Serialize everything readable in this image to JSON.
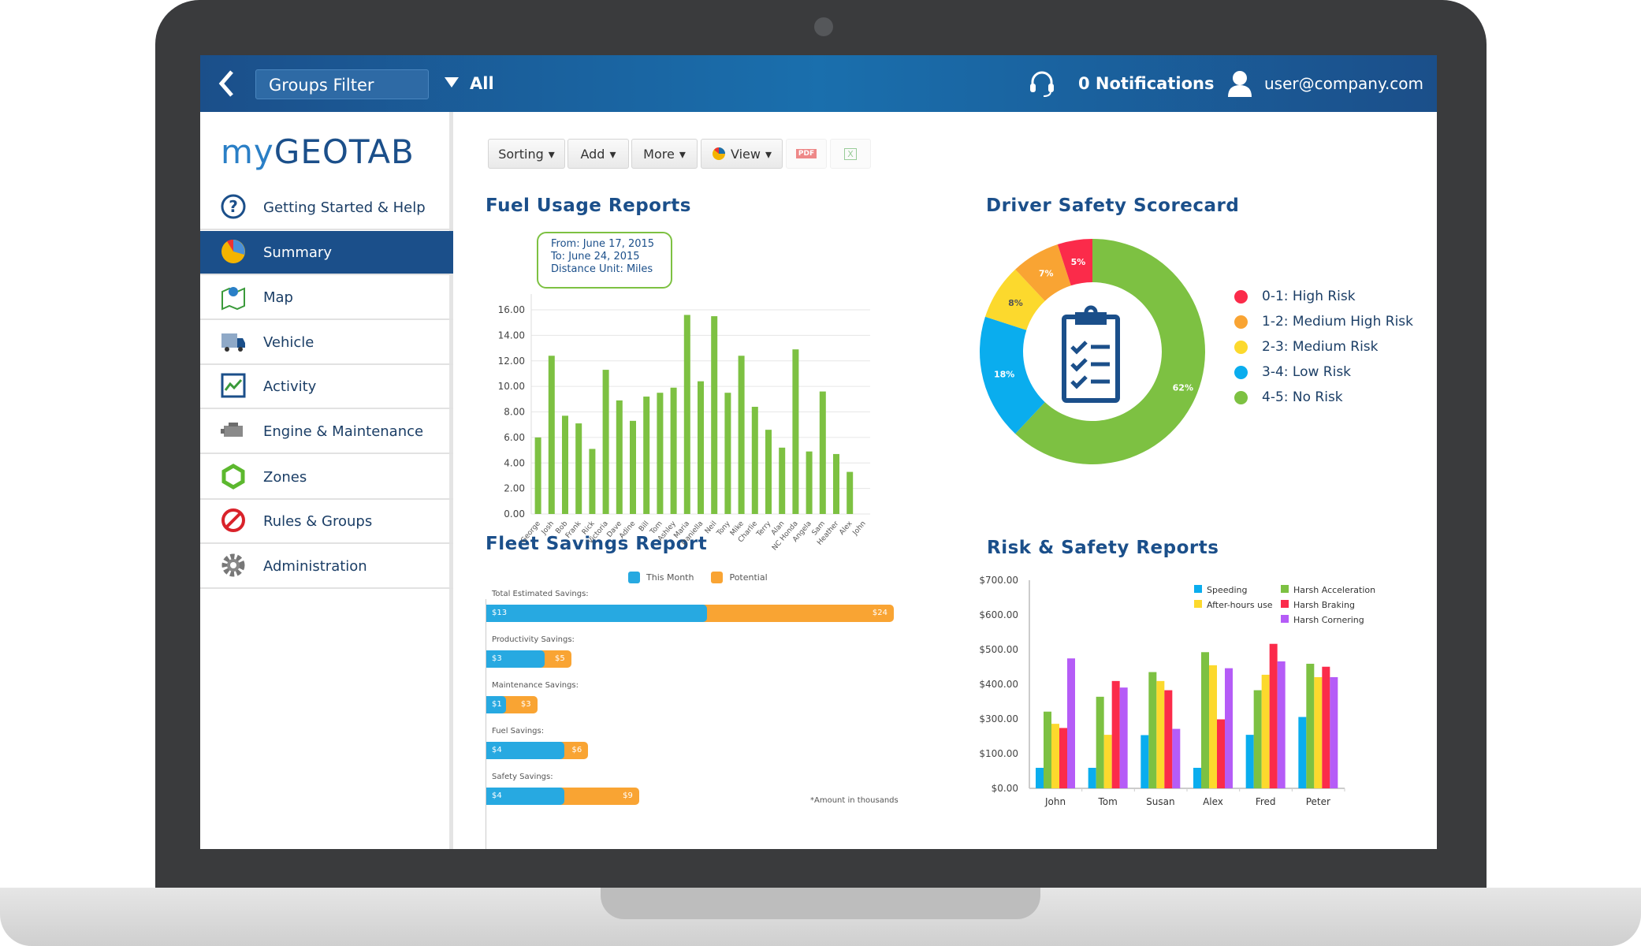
{
  "topbar": {
    "groups_filter": "Groups Filter",
    "filter_value": "All",
    "notifications": "0 Notifications",
    "user": "user@company.com"
  },
  "logo": {
    "prefix": "my",
    "name": "GEOTAB"
  },
  "sidebar": {
    "items": [
      {
        "label": "Getting Started & Help",
        "icon": "help-icon"
      },
      {
        "label": "Summary",
        "icon": "pie-chart-icon",
        "active": true
      },
      {
        "label": "Map",
        "icon": "map-icon"
      },
      {
        "label": "Vehicle",
        "icon": "truck-icon"
      },
      {
        "label": "Activity",
        "icon": "activity-icon"
      },
      {
        "label": "Engine & Maintenance",
        "icon": "engine-icon"
      },
      {
        "label": "Zones",
        "icon": "zones-icon"
      },
      {
        "label": "Rules & Groups",
        "icon": "prohibited-icon"
      },
      {
        "label": "Administration",
        "icon": "gear-icon"
      }
    ]
  },
  "toolbar": {
    "sorting": "Sorting",
    "add": "Add",
    "more": "More",
    "view": "View",
    "pdf": "PDF",
    "excel": "X"
  },
  "fuel": {
    "title": "Fuel Usage Reports",
    "tooltip": [
      "From: June 17, 2015",
      "To: June 24, 2015",
      "Distance Unit: Miles"
    ]
  },
  "safety": {
    "title": "Driver Safety Scorecard"
  },
  "savings": {
    "title": "Fleet Savings Report",
    "note": "*Amount in thousands"
  },
  "risk": {
    "title": "Risk & Safety Reports"
  },
  "chart_data": [
    {
      "type": "bar",
      "title": "Fuel Usage Reports",
      "ylim": [
        0,
        16
      ],
      "yticks": [
        "0.00",
        "2.00",
        "4.00",
        "6.00",
        "8.00",
        "10.00",
        "12.00",
        "14.00",
        "16.00"
      ],
      "grid": true,
      "color": "#7dc142",
      "categories": [
        "George",
        "Josh",
        "Bob",
        "Frank",
        "Rick",
        "Victoria",
        "Dave",
        "Adine",
        "Bill",
        "Tom",
        "Ashley",
        "Maria",
        "Daniella",
        "Neil",
        "Tony",
        "Mike",
        "Charlie",
        "Terry",
        "Alan",
        "NC Honda",
        "Angela",
        "Sam",
        "Heather",
        "Alex",
        "John"
      ],
      "values": [
        6.0,
        12.4,
        7.7,
        7.1,
        5.1,
        11.3,
        8.9,
        7.3,
        9.2,
        9.5,
        9.9,
        15.6,
        10.4,
        15.5,
        9.5,
        12.4,
        8.4,
        6.6,
        5.2,
        12.9,
        4.9,
        9.6,
        4.7,
        3.3,
        0
      ]
    },
    {
      "type": "pie",
      "title": "Driver Safety Scorecard",
      "donut": true,
      "legend": "right",
      "slices": [
        {
          "label": "4-5: No Risk",
          "value": 62,
          "color": "#7dc142"
        },
        {
          "label": "3-4: Low Risk",
          "value": 18,
          "color": "#0aadee"
        },
        {
          "label": "2-3: Medium Risk",
          "value": 8,
          "color": "#fcd92d"
        },
        {
          "label": "1-2: Medium High Risk",
          "value": 7,
          "color": "#f9a433"
        },
        {
          "label": "0-1: High Risk",
          "value": 5,
          "color": "#fb2b4a"
        }
      ],
      "legend_order": [
        "0-1: High Risk",
        "1-2: Medium High Risk",
        "2-3: Medium Risk",
        "3-4: Low Risk",
        "4-5: No Risk"
      ]
    },
    {
      "type": "bar",
      "orientation": "horizontal",
      "stacked": false,
      "title": "Fleet Savings Report",
      "legend": "top",
      "series": [
        {
          "name": "This Month",
          "color": "#27a9e1"
        },
        {
          "name": "Potential",
          "color": "#f9a433"
        }
      ],
      "categories": [
        "Total Estimated Savings:",
        "Productivity Savings:",
        "Maintenance Savings:",
        "Fuel Savings:",
        "Safety Savings:"
      ],
      "this_month": [
        13,
        3,
        1,
        4,
        4
      ],
      "potential": [
        24,
        5,
        3,
        6,
        9
      ],
      "value_prefix": "$",
      "xlim": [
        0,
        24
      ]
    },
    {
      "type": "bar",
      "title": "Risk & Safety Reports",
      "legend": "top-right",
      "ylim": [
        0,
        700
      ],
      "yticks": [
        "$0.00",
        "$100.00",
        "$300.00",
        "$400.00",
        "$500.00",
        "$600.00",
        "$700.00"
      ],
      "categories": [
        "John",
        "Tom",
        "Susan",
        "Alex",
        "Fred",
        "Peter"
      ],
      "series": [
        {
          "name": "Speeding",
          "color": "#0aadee",
          "values": [
            69,
            69,
            179,
            69,
            180,
            240
          ]
        },
        {
          "name": "Harsh Acceleration",
          "color": "#7dc142",
          "values": [
            258,
            308,
            391,
            458,
            330,
            419
          ]
        },
        {
          "name": "After-hours use",
          "color": "#fcd92d",
          "values": [
            217,
            180,
            361,
            414,
            382,
            374
          ]
        },
        {
          "name": "Harsh Braking",
          "color": "#fb2b4a",
          "values": [
            203,
            361,
            330,
            232,
            486,
            409
          ]
        },
        {
          "name": "Harsh Cornering",
          "color": "#b55cf7",
          "values": [
            437,
            339,
            200,
            404,
            427,
            374
          ]
        }
      ]
    }
  ]
}
